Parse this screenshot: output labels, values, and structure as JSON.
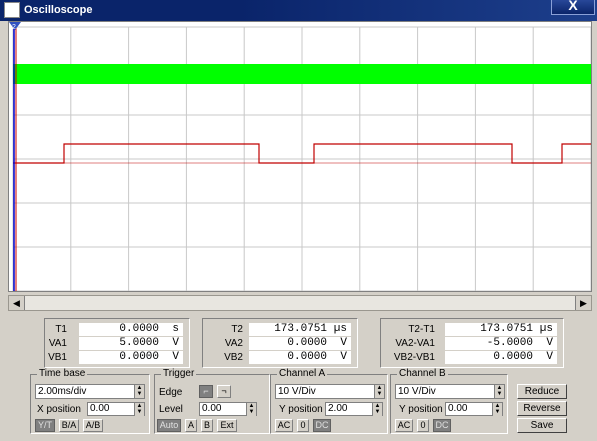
{
  "window": {
    "title": "Oscilloscope",
    "close_label": "X"
  },
  "screen": {
    "grid": true,
    "colors": {
      "background": "#ffffff",
      "grid": "#c8c8c8",
      "channel_a": "#00ff00",
      "channel_b": "#c00000",
      "cursor_1": "#0000cc",
      "cursor_2": "#cc0000"
    },
    "cursor_marker": "2"
  },
  "readout": {
    "t1": {
      "label": "T1",
      "value": "0.0000",
      "unit": "s"
    },
    "va1": {
      "label": "VA1",
      "value": "5.0000",
      "unit": "V"
    },
    "vb1": {
      "label": "VB1",
      "value": "0.0000",
      "unit": "V"
    },
    "t2": {
      "label": "T2",
      "value": "173.0751",
      "unit": "µs"
    },
    "va2": {
      "label": "VA2",
      "value": "0.0000",
      "unit": "V"
    },
    "vb2": {
      "label": "VB2",
      "value": "0.0000",
      "unit": "V"
    },
    "dt": {
      "label": "T2-T1",
      "value": "173.0751",
      "unit": "µs"
    },
    "dva": {
      "label": "VA2-VA1",
      "value": "-5.0000",
      "unit": "V"
    },
    "dvb": {
      "label": "VB2-VB1",
      "value": "0.0000",
      "unit": "V"
    }
  },
  "timebase": {
    "title": "Time base",
    "scale": "2.00ms/div",
    "xpos_label": "X position",
    "xpos": "0.00",
    "modes": [
      "Y/T",
      "B/A",
      "A/B"
    ]
  },
  "trigger": {
    "title": "Trigger",
    "edge_label": "Edge",
    "level_label": "Level",
    "level": "0.00",
    "sources": [
      "Auto",
      "A",
      "B",
      "Ext"
    ]
  },
  "channel_a": {
    "title": "Channel A",
    "scale": "10 V/Div",
    "ypos_label": "Y position",
    "ypos": "2.00",
    "coupling": [
      "AC",
      "0",
      "DC"
    ]
  },
  "channel_b": {
    "title": "Channel B",
    "scale": "10 V/Div",
    "ypos_label": "Y position",
    "ypos": "0.00",
    "coupling": [
      "AC",
      "0",
      "DC"
    ]
  },
  "buttons": {
    "reduce": "Reduce",
    "reverse": "Reverse",
    "save": "Save"
  }
}
